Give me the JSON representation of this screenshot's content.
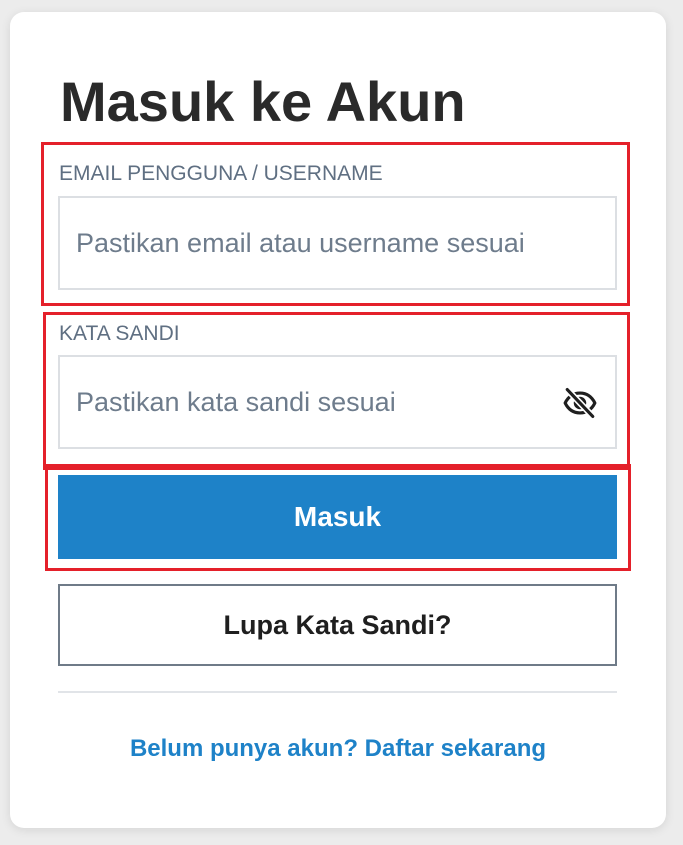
{
  "page": {
    "title": "Masuk ke Akun"
  },
  "form": {
    "username": {
      "label": "EMAIL PENGGUNA / USERNAME",
      "placeholder": "Pastikan email atau username sesuai",
      "value": ""
    },
    "password": {
      "label": "KATA SANDI",
      "placeholder": "Pastikan kata sandi sesuai",
      "value": "",
      "toggle_icon": "eye-slash-icon"
    },
    "submit_label": "Masuk",
    "forgot_label": "Lupa Kata Sandi?"
  },
  "footer": {
    "register_link": "Belum punya akun? Daftar sekarang"
  },
  "colors": {
    "primary": "#1e82c8",
    "title_text": "#2a2a2a",
    "label_text": "#5f6f82",
    "highlight": "#e4202a"
  }
}
